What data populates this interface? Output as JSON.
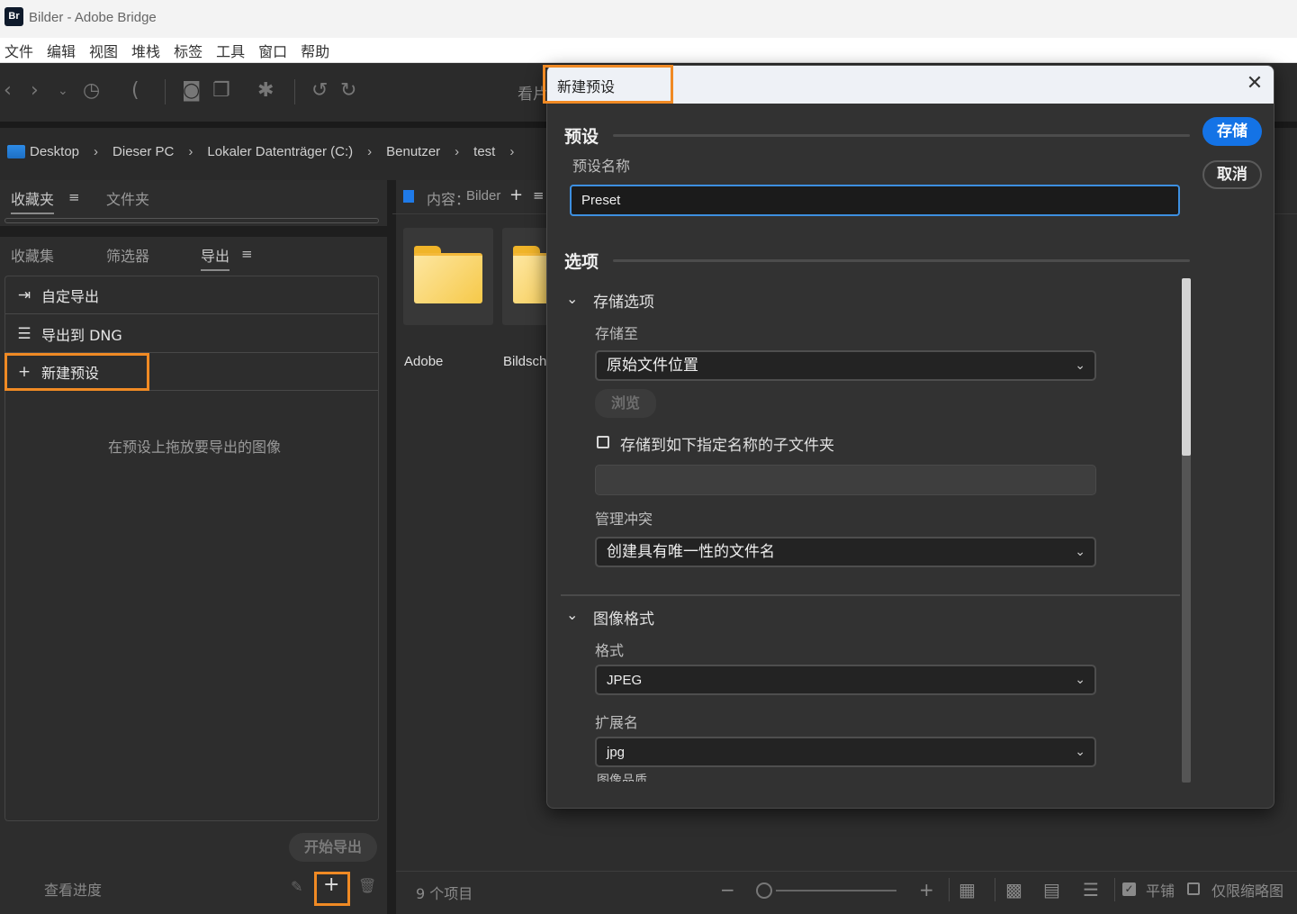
{
  "window": {
    "app_logo": "Br",
    "title": "Bilder - Adobe Bridge"
  },
  "menu": [
    "文件",
    "编辑",
    "视图",
    "堆栈",
    "标签",
    "工具",
    "窗口",
    "帮助"
  ],
  "toolbar": {
    "icons": [
      "back-icon",
      "forward-icon",
      "history-dropdown-icon",
      "recent-icon",
      "boomerang-icon",
      "camera-import-icon",
      "copy-dropdown-icon",
      "refine-icon",
      "rotate-left-icon",
      "rotate-right-icon"
    ],
    "partial_label": "看片"
  },
  "breadcrumb": [
    "Desktop",
    "Dieser PC",
    "Lokaler Datenträger (C:)",
    "Benutzer",
    "test"
  ],
  "left_panel": {
    "top_tabs": [
      {
        "label": "收藏夹",
        "active": true
      },
      {
        "label": "文件夹",
        "active": false
      }
    ],
    "main_tabs": [
      {
        "label": "收藏集",
        "active": false
      },
      {
        "label": "筛选器",
        "active": false
      },
      {
        "label": "导出",
        "active": true
      }
    ],
    "export_items": [
      {
        "icon": "export-icon",
        "label": "自定导出"
      },
      {
        "icon": "list-icon",
        "label": "导出到 DNG"
      },
      {
        "icon": "plus-icon",
        "label": "新建预设"
      }
    ],
    "hint": "在预设上拖放要导出的图像",
    "start_export_label": "开始导出",
    "view_progress_label": "查看进度"
  },
  "content": {
    "header_label": "内容：",
    "folder_name": "Bilder",
    "items": [
      {
        "name": "Adobe"
      },
      {
        "name": "Bildschi"
      }
    ],
    "item_count": "9 个项目",
    "tile_checked": true,
    "tile_label": "平铺",
    "thumbs_only_checked": false,
    "thumbs_only_label": "仅限缩略图"
  },
  "dialog": {
    "title": "新建预设",
    "close_label": "✕",
    "save_label": "存储",
    "cancel_label": "取消",
    "preset_section": "预设",
    "preset_name_label": "预设名称",
    "preset_name_value": "Preset",
    "options_section": "选项",
    "storage": {
      "title": "存储选项",
      "save_to_label": "存储至",
      "save_to_value": "原始文件位置",
      "browse_label": "浏览",
      "subfolder_checked": false,
      "subfolder_label": "存储到如下指定名称的子文件夹",
      "subfolder_value": "",
      "conflict_label": "管理冲突",
      "conflict_value": "创建具有唯一性的文件名"
    },
    "image_format": {
      "title": "图像格式",
      "format_label": "格式",
      "format_value": "JPEG",
      "extension_label": "扩展名",
      "extension_value": "jpg",
      "next_label_partial": "图像品质"
    }
  },
  "highlight_color": "#f08a24",
  "accent_color": "#1473e6"
}
